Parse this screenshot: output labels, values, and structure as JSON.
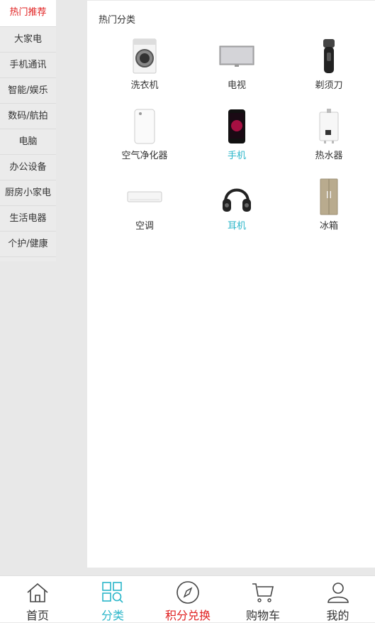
{
  "sidebar": {
    "items": [
      {
        "label": "热门推荐",
        "active": true
      },
      {
        "label": "大家电"
      },
      {
        "label": "手机通讯"
      },
      {
        "label": "智能/娱乐"
      },
      {
        "label": "数码/航拍"
      },
      {
        "label": "电脑"
      },
      {
        "label": "办公设备"
      },
      {
        "label": "厨房小家电"
      },
      {
        "label": "生活电器"
      },
      {
        "label": "个护/健康"
      }
    ]
  },
  "main": {
    "section_title": "热门分类",
    "categories": [
      {
        "label": "洗衣机",
        "icon": "washing-machine-icon"
      },
      {
        "label": "电视",
        "icon": "tv-icon"
      },
      {
        "label": "剃须刀",
        "icon": "shaver-icon"
      },
      {
        "label": "空气净化器",
        "icon": "air-purifier-icon"
      },
      {
        "label": "手机",
        "icon": "phone-icon",
        "highlight": true
      },
      {
        "label": "热水器",
        "icon": "water-heater-icon"
      },
      {
        "label": "空调",
        "icon": "air-conditioner-icon"
      },
      {
        "label": "耳机",
        "icon": "headphones-icon",
        "highlight": true
      },
      {
        "label": "冰箱",
        "icon": "refrigerator-icon"
      }
    ]
  },
  "tabbar": {
    "tabs": [
      {
        "label": "首页",
        "icon": "home-icon",
        "color": "#333333"
      },
      {
        "label": "分类",
        "icon": "category-icon",
        "color": "#2ab6c9",
        "active": true
      },
      {
        "label": "积分兑换",
        "icon": "compass-icon",
        "color": "#e02020"
      },
      {
        "label": "购物车",
        "icon": "cart-icon",
        "color": "#333333"
      },
      {
        "label": "我的",
        "icon": "user-icon",
        "color": "#333333"
      }
    ]
  },
  "colors": {
    "accent": "#2ab6c9",
    "brand_red": "#e02020"
  }
}
